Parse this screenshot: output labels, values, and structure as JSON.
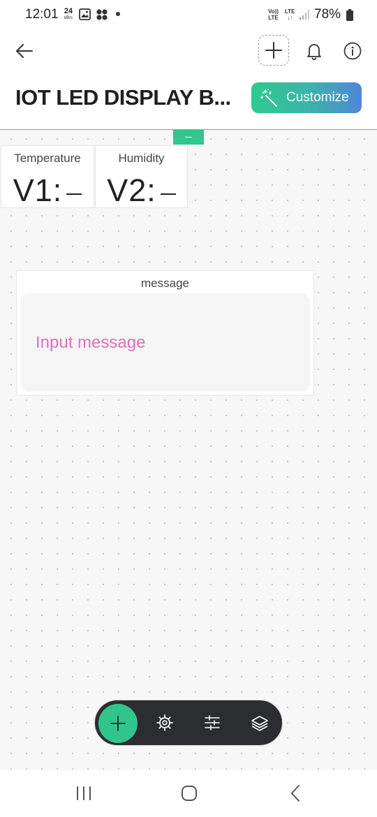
{
  "status_bar": {
    "time": "12:01",
    "speed_value": "24",
    "speed_unit": "kB/s",
    "volte_top": "Vo))",
    "volte_bottom": "LTE",
    "lte_top": "LTE",
    "lte_bottom": "↓↑",
    "battery": "78%",
    "icons": [
      "image-icon",
      "fan-icon",
      "dot-icon",
      "signal-icon",
      "battery-icon"
    ]
  },
  "header": {
    "title": "IOT LED DISPLAY B...",
    "customize_label": "Customize",
    "icons": [
      "back-arrow-icon",
      "plus-icon",
      "bell-icon",
      "info-icon",
      "magic-wand-icon"
    ]
  },
  "widgets": {
    "temperature": {
      "label": "Temperature",
      "pin": "V1:"
    },
    "humidity": {
      "label": "Humidity",
      "pin": "V2:"
    },
    "message": {
      "label": "message",
      "placeholder": "Input message"
    }
  },
  "toolbar": {
    "icons": [
      "plus-icon",
      "gear-icon",
      "sliders-icon",
      "layers-icon"
    ]
  },
  "nav": {
    "icons": [
      "recent-apps-icon",
      "home-icon",
      "back-icon"
    ]
  },
  "colors": {
    "accent": "#31c48d",
    "gradient_start": "#2fc990",
    "gradient_end": "#4f86d8",
    "placeholder": "#e06fbf",
    "toolbar_bg": "#2b2d31"
  }
}
